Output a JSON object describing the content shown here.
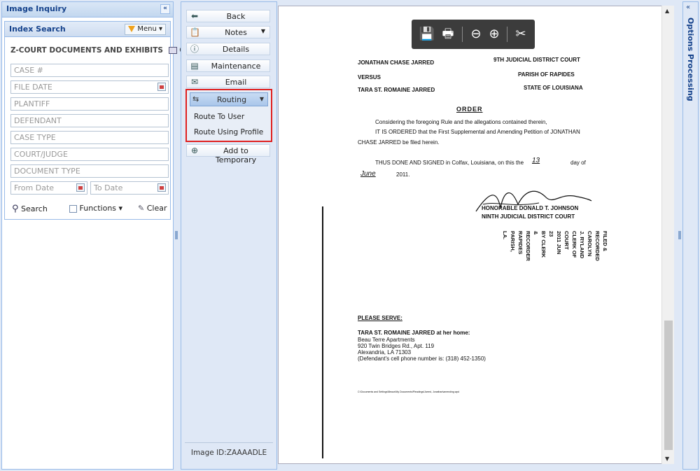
{
  "left_panel": {
    "title": "Image Inquiry",
    "collapse_glyph": "«",
    "index_search": {
      "title": "Index Search",
      "menu_label": "Menu",
      "section_title": "Z-COURT DOCUMENTS AND EXHIBITS",
      "section_suffix": "Cl",
      "fields": {
        "case_no": "CASE #",
        "file_date": "FILE DATE",
        "plantiff": "PLANTIFF",
        "defendant": "DEFENDANT",
        "case_type": "CASE TYPE",
        "court_judge": "COURT/JUDGE",
        "document_type": "DOCUMENT TYPE",
        "from_date": "From Date",
        "to_date": "To Date"
      },
      "search_label": "Search",
      "functions_label": "Functions",
      "clear_label": "Clear"
    }
  },
  "toolbar": {
    "back": "Back",
    "notes": "Notes",
    "details": "Details",
    "maintenance": "Maintenance",
    "email": "Email",
    "routing": "Routing",
    "route_to_user": "Route To User",
    "route_using_profile": "Route Using Profile",
    "add_to_temporary": "Add to Temporary",
    "image_id": "Image ID:ZAAAADLE"
  },
  "document": {
    "party1": "JONATHAN CHASE JARRED",
    "court": "9TH JUDICIAL DISTRICT COURT",
    "versus": "VERSUS",
    "parish": "PARISH OF RAPIDES",
    "party2": "TARA ST. ROMAINE JARRED",
    "state": "STATE OF LOUISIANA",
    "order_title": "ORDER",
    "line1": "Considering the foregoing Rule and the allegations contained therein,",
    "line2": "IT IS ORDERED that the First Supplemental and Amending Petition of JONATHAN",
    "line3": "CHASE JARRED be filed herein.",
    "line4": "THUS DONE AND SIGNED in Colfax, Louisiana, on this the",
    "day_handwritten": "13",
    "day_of": "day of",
    "month_handwritten": "June",
    "year": "2011.",
    "judge": "HONORABLE DONALD T. JOHNSON",
    "judge_court": "NINTH JUDICIAL DISTRICT COURT",
    "please_serve": "PLEASE SERVE:",
    "serve1": "TARA ST. ROMAINE JARRED at her home:",
    "serve2": "Beau Terre Apartments",
    "serve3": "920 Twin Bridges Rd., Apt. 119",
    "serve4": "Alexandria, LA 71303",
    "serve5": "(Defendant's cell phone number is: (318) 452-1350)",
    "footer": "C:\\Documents and Settings\\Beaux\\My Documents\\Pleadings\\Jarred, Jonathan\\amending.wpd",
    "stamp_lines": [
      "FILED & RECORDED",
      "CAROLYN J. RYLAND",
      "CLERK OF COURT",
      "2011 JUN 23",
      "BY CLERK & RECORDER",
      "RAPIDES PARISH, LA."
    ]
  },
  "pdf_toolbar": {
    "save_icon": "save-icon",
    "print_icon": "print-icon",
    "zoom_out_icon": "zoom-out-icon",
    "zoom_in_icon": "zoom-in-icon",
    "acrobat_icon": "acrobat-icon"
  },
  "right_panel": {
    "title": "Options Processing",
    "collapse_glyph": "«"
  }
}
